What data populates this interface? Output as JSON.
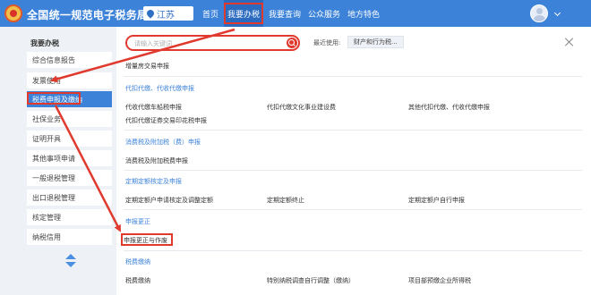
{
  "header": {
    "site_title": "全国统一规范电子税务局",
    "region": "江苏",
    "nav": [
      "首页",
      "我要办税",
      "我要查询",
      "公众服务",
      "地方特色"
    ]
  },
  "sidebar": {
    "title": "我要办税",
    "items": [
      "综合信息报告",
      "发票使用",
      "税费申报及缴纳",
      "社保业务",
      "证明开具",
      "其他事项申请",
      "一般退税管理",
      "出口退税管理",
      "核定管理",
      "纳税信用"
    ]
  },
  "main": {
    "search_placeholder": "请输入关键词",
    "recent_label": "最近使用:",
    "recent_tag": "财产和行为税...",
    "sections": [
      {
        "title": "",
        "items": [
          "增量房交易申报"
        ]
      },
      {
        "title": "代扣代缴、代收代缴申报",
        "items": [
          "代收代缴车船税申报",
          "代扣代缴文化事业建设费",
          "其他代扣代缴、代收代缴申报",
          "代扣代缴证券交易印花税申报"
        ]
      },
      {
        "title": "消费税及附加税（费）申报",
        "items": [
          "消费税及附加税费申报"
        ]
      },
      {
        "title": "定期定额核定及申报",
        "items": [
          "定期定额户申请核定及调整定额",
          "定期定额终止",
          "定期定额户自行申报"
        ]
      },
      {
        "title": "申报更正",
        "items": [
          "申报更正与作废"
        ]
      },
      {
        "title": "税费缴纳",
        "items": [
          "税费缴纳",
          "特别纳税调查自行调整（缴纳）",
          "项目部预缴企业所得税"
        ]
      }
    ]
  },
  "colors": {
    "brand": "#3c82d8",
    "highlight": "#e03a2f",
    "sidebar_bg": "#eef1f6"
  },
  "icons": [
    "emblem-icon",
    "location-pin-icon",
    "avatar-icon",
    "chevron-down-icon",
    "search-icon",
    "close-icon",
    "scroll-up-icon",
    "scroll-down-icon"
  ]
}
